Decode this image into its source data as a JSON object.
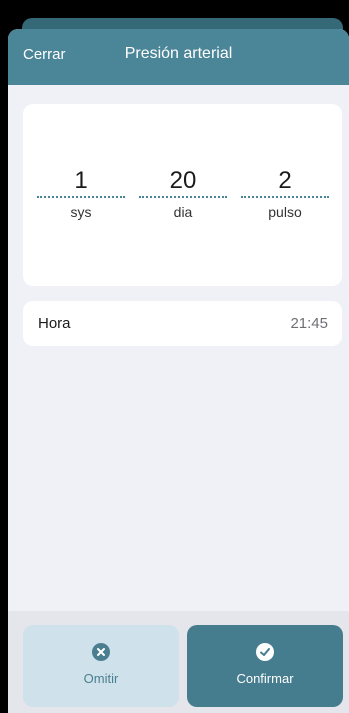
{
  "header": {
    "close_label": "Cerrar",
    "title": "Presión arterial"
  },
  "fields": [
    {
      "value": "1",
      "label": "sys"
    },
    {
      "value": "20",
      "label": "dia"
    },
    {
      "value": "2",
      "label": "pulso"
    }
  ],
  "time_row": {
    "label": "Hora",
    "value": "21:45"
  },
  "footer": {
    "skip": {
      "label": "Omitir",
      "icon": "close-circle-icon"
    },
    "confirm": {
      "label": "Confirmar",
      "icon": "check-circle-icon"
    }
  },
  "colors": {
    "header": "#4b8698",
    "background": "#eff1f6",
    "confirm_button": "#457d8e",
    "skip_button": "#cfe1ea"
  }
}
